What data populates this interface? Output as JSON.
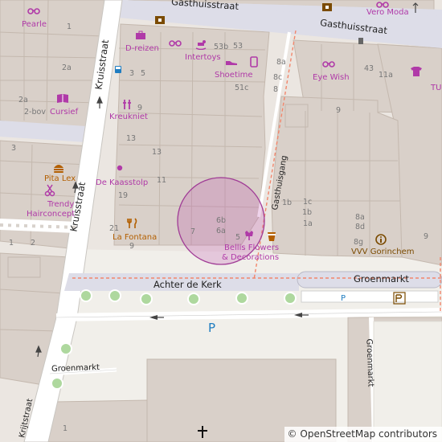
{
  "streets": {
    "gasthuisstraat_1": "Gasthuisstraat",
    "gasthuisstraat_2": "Gasthuisstraat",
    "kruisstraat_1": "Kruisstraat",
    "kruisstraat_2": "Kruisstraat",
    "gasthuisgang": "Gasthuisgang",
    "achter_de_kerk": "Achter de Kerk",
    "groenmarkt_main": "Groenmarkt",
    "groenmarkt_left": "Groenmarkt",
    "groenmarkt_right": "Groenmarkt",
    "krijtstraat": "Krijtstraat"
  },
  "pois": {
    "pearle": "Pearle",
    "d_reizen": "D-reizen",
    "intertoys": "Intertoys",
    "shoetime": "Shoetime",
    "eye_wish": "Eye Wish",
    "vero_moda": "Vero Moda",
    "tu": "TU",
    "cursief": "Cursief",
    "kreukniet": "Kreukniet",
    "pita_lex": "Pita Lex",
    "de_kaasstolp": "De Kaasstolp",
    "trendy_1": "Trendy",
    "trendy_2": "Hairconcept",
    "la_fontana": "La Fontana",
    "bellis_1": "Bellis Flowers",
    "bellis_2": "& Decorations",
    "vvv": "VVV Gorinchem",
    "parking_large": "P",
    "parking_small": "P"
  },
  "house_numbers": {
    "n1": "1",
    "n2a": "2a",
    "n2a_b": "2a",
    "n2bov": "2-bov",
    "n3": "3",
    "n5": "5",
    "n9": "9",
    "n13": "13",
    "n13b": "13",
    "n11": "11",
    "n19": "19",
    "n21": "21",
    "n9b": "9",
    "n3b": "3",
    "n1b": "1",
    "n2": "2",
    "n53b": "53b",
    "n53": "53",
    "n51c": "51c",
    "n8a": "8a",
    "n8c": "8c",
    "n8": "8",
    "n43": "43",
    "n11a": "11a",
    "n9c": "9",
    "n1c": "1c",
    "n1b2": "1b",
    "n1a": "1a",
    "n1b3": "1b",
    "n8a2": "8a",
    "n8d": "8d",
    "n8g": "8g",
    "n9d": "9",
    "n6b": "6b",
    "n6a": "6a",
    "n7": "7",
    "n5b": "5",
    "n1bottom": "1"
  },
  "colors": {
    "background": "#ebe6e1",
    "building": "#d9d0c9",
    "building_stroke": "#c4b8ae",
    "road": "#ffffff",
    "pedestrian": "#dddde8",
    "square": "#f2efe9",
    "poi": "#b03aa8",
    "food": "#b35f00",
    "highlight": "#c050b0",
    "park_dot": "#aed89e"
  },
  "icons": [
    "glasses-icon",
    "suitcase-icon",
    "rocking-horse-icon",
    "shoe-icon",
    "phone-icon",
    "tshirt-icon",
    "book-icon",
    "dry-cleaning-icon",
    "burger-icon",
    "hairdresser-icon",
    "restaurant-icon",
    "florist-icon",
    "info-icon",
    "bus-stop-icon",
    "museum-icon",
    "church-cross-icon",
    "parking-icon"
  ],
  "attribution": {
    "copyright": "©",
    "text": "OpenStreetMap contributors"
  }
}
